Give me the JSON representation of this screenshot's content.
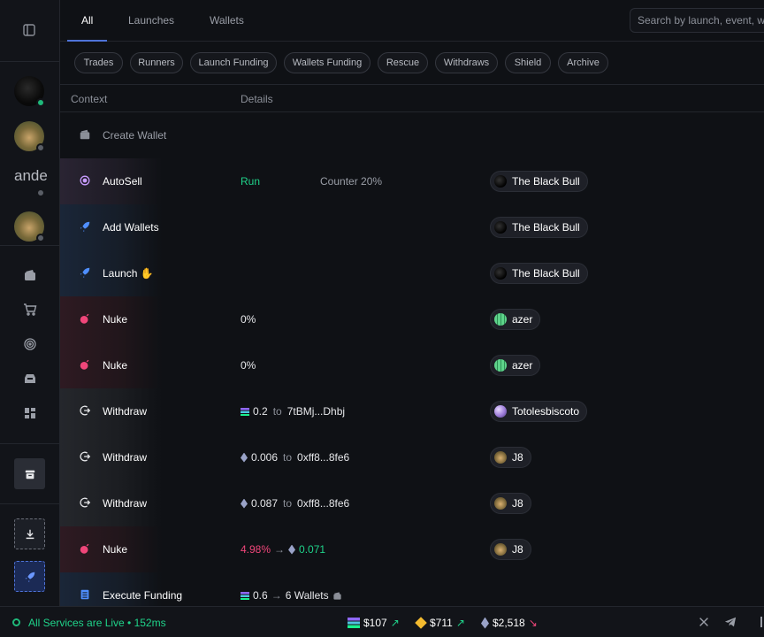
{
  "tabs": [
    {
      "label": "All",
      "active": true
    },
    {
      "label": "Launches",
      "active": false
    },
    {
      "label": "Wallets",
      "active": false
    }
  ],
  "search": {
    "placeholder": "Search by launch, event, w"
  },
  "filters": [
    "Trades",
    "Runners",
    "Launch Funding",
    "Wallets Funding",
    "Rescue",
    "Withdraws",
    "Shield",
    "Archive"
  ],
  "sidebar": {
    "text_item": "ande"
  },
  "columns": {
    "context": "Context",
    "details": "Details"
  },
  "rows": [
    {
      "icon": "wallet-icon",
      "context": "Create Wallet",
      "details": "",
      "account": ""
    },
    {
      "icon": "autosell-icon",
      "context": "AutoSell",
      "details": "Run",
      "details_extra": "Counter 20%",
      "account": "The Black Bull"
    },
    {
      "icon": "rocket-icon",
      "context": "Add Wallets",
      "details": "",
      "account": "The Black Bull"
    },
    {
      "icon": "rocket-icon",
      "context": "Launch ✋",
      "details": "",
      "account": "The Black Bull"
    },
    {
      "icon": "bomb-icon",
      "context": "Nuke",
      "details": "0%",
      "account": "azer"
    },
    {
      "icon": "bomb-icon",
      "context": "Nuke",
      "details": "0%",
      "account": "azer"
    },
    {
      "icon": "withdraw-icon",
      "context": "Withdraw",
      "amount": "0.2",
      "to_word": "to",
      "address": "7tBMj...Dhbj",
      "token": "sol",
      "account": "Totolesbiscoto"
    },
    {
      "icon": "withdraw-icon",
      "context": "Withdraw",
      "amount": "0.006",
      "to_word": "to",
      "address": "0xff8...8fe6",
      "token": "eth",
      "account": "J8"
    },
    {
      "icon": "withdraw-icon",
      "context": "Withdraw",
      "amount": "0.087",
      "to_word": "to",
      "address": "0xff8...8fe6",
      "token": "eth",
      "account": "J8"
    },
    {
      "icon": "bomb-icon",
      "context": "Nuke",
      "pct": "4.98%",
      "arrow": "→",
      "value": "0.071",
      "account": "J8"
    },
    {
      "icon": "funding-icon",
      "context": "Execute Funding",
      "amount": "0.6",
      "arrow": "→",
      "target": "6 Wallets"
    }
  ],
  "footer": {
    "status": "All Services are Live • 152ms",
    "prices": [
      {
        "token": "sol",
        "value": "$107",
        "trend": "up"
      },
      {
        "token": "bnb",
        "value": "$711",
        "trend": "up"
      },
      {
        "token": "eth",
        "value": "$2,518",
        "trend": "down"
      }
    ],
    "trend_up": "↗",
    "trend_down": "↘"
  },
  "colors": {
    "accent": "#4f73d8",
    "green": "#1fd38a",
    "red": "#f0467a"
  }
}
